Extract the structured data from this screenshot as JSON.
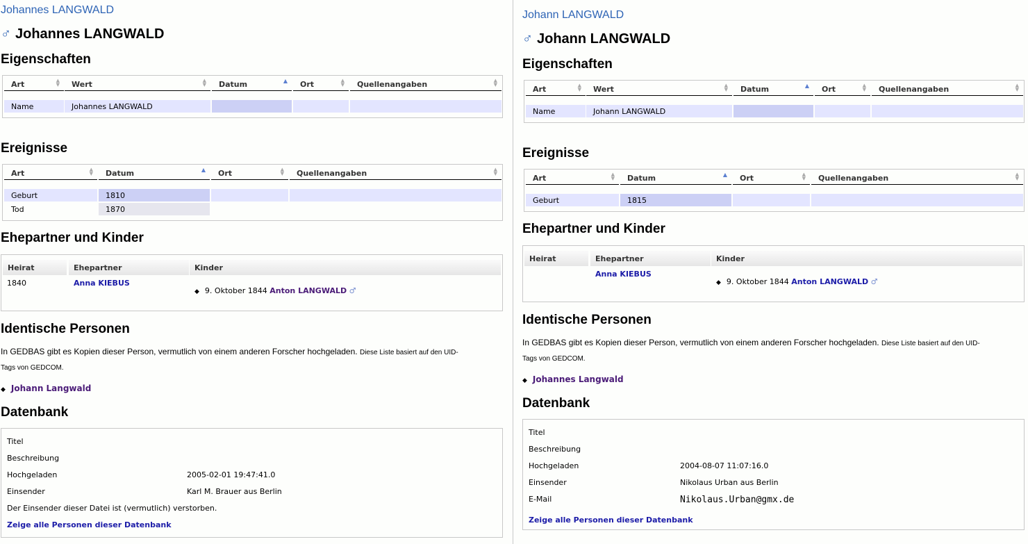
{
  "left": {
    "breadcrumb": "Johannes LANGWALD",
    "gender_symbol": "♂",
    "name": "Johannes LANGWALD",
    "headings": {
      "properties": "Eigenschaften",
      "events": "Ereignisse",
      "family": "Ehepartner und Kinder",
      "identical": "Identische Personen",
      "database": "Datenbank"
    },
    "properties_table": {
      "columns": [
        "Art",
        "Wert",
        "Datum",
        "Ort",
        "Quellenangaben"
      ],
      "rows": [
        [
          "Name",
          "Johannes LANGWALD",
          "",
          "",
          ""
        ]
      ]
    },
    "events_table": {
      "columns": [
        "Art",
        "Datum",
        "Ort",
        "Quellenangaben"
      ],
      "rows": [
        [
          "Geburt",
          "1810",
          "",
          ""
        ],
        [
          "Tod",
          "1870",
          "",
          ""
        ]
      ]
    },
    "family": {
      "columns": [
        "Heirat",
        "Ehepartner",
        "Kinder"
      ],
      "marriage": "1840",
      "spouse": "Anna KIEBUS",
      "child_date": "9. Oktober 1844",
      "child_name": "Anton LANGWALD",
      "child_gender": "♂"
    },
    "identical": {
      "text": "In GEDBAS gibt es Kopien dieser Person, vermutlich von einem anderen Forscher hochgeladen.",
      "note_line1": "Diese Liste basiert auf den UID-",
      "note_line2": "Tags von GEDCOM.",
      "person": "Johann Langwald"
    },
    "database": {
      "title_label": "Titel",
      "description_label": "Beschreibung",
      "uploaded_label": "Hochgeladen",
      "uploaded_value": "2005-02-01 19:47:41.0",
      "submitter_label": "Einsender",
      "submitter_value": "Karl M. Brauer aus Berlin",
      "deceased_note": "Der Einsender dieser Datei ist (vermutlich) verstorben.",
      "show_all_link": "Zeige alle Personen dieser Datenbank"
    }
  },
  "right": {
    "breadcrumb": "Johann LANGWALD",
    "gender_symbol": "♂",
    "name": "Johann LANGWALD",
    "headings": {
      "properties": "Eigenschaften",
      "events": "Ereignisse",
      "family": "Ehepartner und Kinder",
      "identical": "Identische Personen",
      "database": "Datenbank"
    },
    "properties_table": {
      "columns": [
        "Art",
        "Wert",
        "Datum",
        "Ort",
        "Quellenangaben"
      ],
      "rows": [
        [
          "Name",
          "Johann LANGWALD",
          "",
          "",
          ""
        ]
      ]
    },
    "events_table": {
      "columns": [
        "Art",
        "Datum",
        "Ort",
        "Quellenangaben"
      ],
      "rows": [
        [
          "Geburt",
          "1815",
          "",
          ""
        ]
      ]
    },
    "family": {
      "columns": [
        "Heirat",
        "Ehepartner",
        "Kinder"
      ],
      "marriage": "",
      "spouse": "Anna KIEBUS",
      "child_date": "9. Oktober 1844",
      "child_name": "Anton LANGWALD",
      "child_gender": "♂"
    },
    "identical": {
      "text": "In GEDBAS gibt es Kopien dieser Person, vermutlich von einem anderen Forscher hochgeladen.",
      "note_line1": "Diese Liste basiert auf den UID-",
      "note_line2": "Tags von GEDCOM.",
      "person": "Johannes Langwald"
    },
    "database": {
      "title_label": "Titel",
      "description_label": "Beschreibung",
      "uploaded_label": "Hochgeladen",
      "uploaded_value": "2004-08-07 11:07:16.0",
      "submitter_label": "Einsender",
      "submitter_value": "Nikolaus Urban aus Berlin",
      "email_label": "E-Mail",
      "email_value": "Nikolaus.Urban@gmx.de",
      "show_all_link": "Zeige alle Personen dieser Datenbank"
    }
  }
}
